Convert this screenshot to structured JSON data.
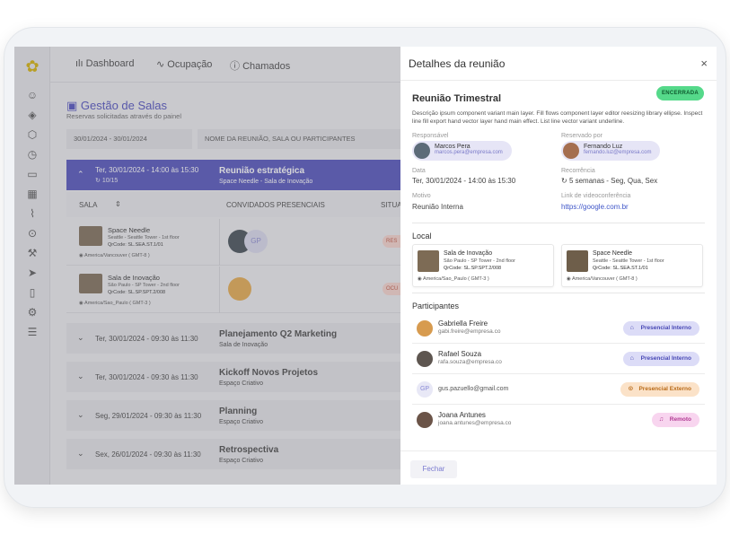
{
  "nav": {
    "dashboard": "Dashboard",
    "ocupacao": "Ocupação",
    "chamados": "Chamados"
  },
  "page": {
    "title": "Gestão de Salas",
    "subtitle": "Reservas solicitadas através do painel"
  },
  "filters": {
    "date_range": "30/01/2024 - 30/01/2024",
    "search_placeholder": "NOME DA REUNIÃO, SALA OU PARTICIPANTES"
  },
  "groups": [
    {
      "date": "Ter, 30/01/2024 - 14:00 às 15:30",
      "sub": "10/15",
      "name": "Reunião estratégica",
      "location": "Space Needle - Sala de Inovação"
    },
    {
      "date": "Ter, 30/01/2024 - 09:30 às 11:30",
      "name": "Planejamento Q2 Marketing",
      "location": "Sala de Inovação"
    },
    {
      "date": "Ter, 30/01/2024 - 09:30 às 11:30",
      "name": "Kickoff Novos Projetos",
      "location": "Espaço Criativo"
    },
    {
      "date": "Seg, 29/01/2024 - 09:30 às 11:30",
      "name": "Planning",
      "location": "Espaço Criativo"
    },
    {
      "date": "Sex, 26/01/2024 - 09:30 às 11:30",
      "name": "Retrospectiva",
      "location": "Espaço Criativo"
    }
  ],
  "table": {
    "col_sala": "SALA",
    "col_convidados": "CONVIDADOS PRESENCIAIS",
    "col_situ": "SITUA"
  },
  "rows": [
    {
      "name": "Space Needle",
      "addr": "Seattle - Seattle Tower - 1st floor",
      "qr": "QrCode: SL.SEA.ST.1/01",
      "tz": "America/Vancouver ( GMT-8 )",
      "initials": "GP",
      "badge": "RES"
    },
    {
      "name": "Sala de Inovação",
      "addr": "São Paulo - SP Tower - 2nd floor",
      "qr": "QrCode: SL.SP.SPT.2/008",
      "tz": "America/Sao_Paulo ( GMT-3 )",
      "badge": "OCU"
    }
  ],
  "drawer": {
    "title": "Detalhes da reunião",
    "close": "×",
    "meeting_title": "Reunião Trimestral",
    "status": "ENCERRADA",
    "description": "Descrição ipsum component variant main layer. Fill flows component layer editor reesizing library ellipse. Inspect line fill export hand vector layer hand main effect. List line vector variant underline.",
    "responsavel_label": "Responsável",
    "responsavel": {
      "name": "Marcos Pera",
      "email": "marcos.pera@empresa.com"
    },
    "reservado_label": "Reservado por",
    "reservado": {
      "name": "Fernando Luz",
      "email": "fernando.luz@empresa.com"
    },
    "data_label": "Data",
    "data_value": "Ter, 30/01/2024 - 14:00 às 15:30",
    "recorrencia_label": "Recorrência",
    "recorrencia_value": "5 semanas - Seg, Qua, Sex",
    "motivo_label": "Motivo",
    "motivo_value": "Reunião Interna",
    "link_label": "Link de videoconferência",
    "link_value": "https://google.com.br",
    "local_title": "Local",
    "locais": [
      {
        "name": "Sala de Inovação",
        "addr": "São Paulo - SP Tower - 2nd floor",
        "qr": "QrCode: SL.SP.SPT.2/008",
        "tz": "America/Sao_Paulo ( GMT-3 )"
      },
      {
        "name": "Space Needle",
        "addr": "Seattle - Seattle Tower - 1st floor",
        "qr": "QrCode: SL.SEA.ST.1/01",
        "tz": "America/Vancouver ( GMT-8 )"
      }
    ],
    "participantes_title": "Participantes",
    "participantes": [
      {
        "name": "Gabriella Freire",
        "email": "gabi.freire@empresa.co",
        "tag": "Presencial Interno"
      },
      {
        "name": "Rafael Souza",
        "email": "rafa.souza@empresa.co",
        "tag": "Presencial Interno"
      },
      {
        "initials": "GP",
        "email": "gus.pazuello@gmail.com",
        "tag": "Presencial Externo"
      },
      {
        "name": "Joana Antunes",
        "email": "joana.antunes@empresa.co",
        "tag": "Remoto"
      }
    ],
    "fechar": "Fechar"
  },
  "colors": {
    "accent": "#4e4ebb",
    "status_green": "#55d98a",
    "link": "#3e55c8"
  }
}
